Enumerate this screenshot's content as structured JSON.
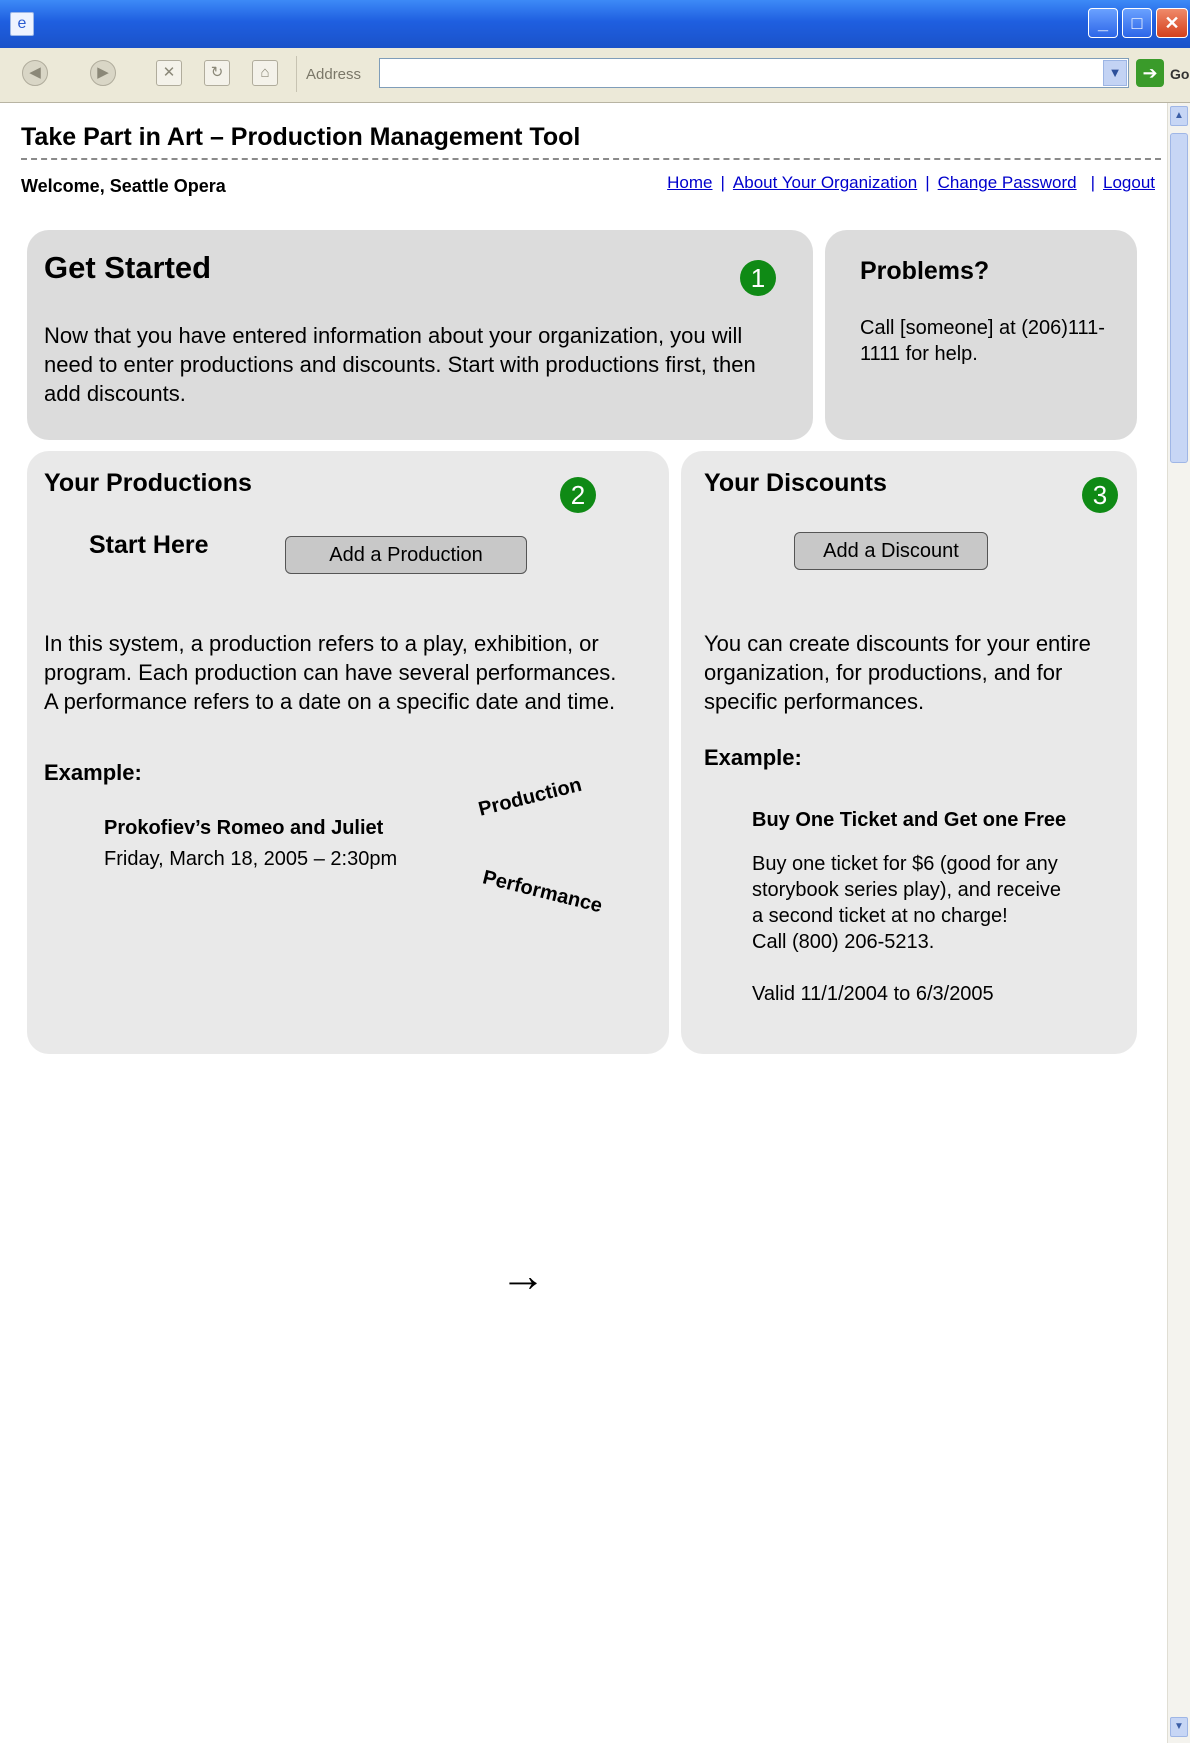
{
  "browser": {
    "address_label": "Address",
    "address_value": "",
    "go_label": "Go"
  },
  "page": {
    "title": "Take Part in Art – Production Management Tool",
    "welcome": "Welcome, Seattle Opera",
    "nav": [
      {
        "label": "Home"
      },
      {
        "label": "About Your Organization"
      },
      {
        "label": "Change Password"
      },
      {
        "label": "Logout"
      }
    ],
    "nav_separator": "|"
  },
  "get_started": {
    "heading": "Get Started",
    "step": "1",
    "body": "Now that you have entered information about your organization, you will need to enter productions and discounts. Start with productions first, then add discounts."
  },
  "problems": {
    "heading": "Problems?",
    "body": "Call [someone] at (206)111-1111 for help."
  },
  "productions": {
    "heading": "Your Productions",
    "step": "2",
    "start_here": "Start Here",
    "add_button": "Add a Production",
    "body": "In this system, a production refers to a play, exhibition, or program. Each production can have several performances. A performance refers to a date on a specific date and time.",
    "example_label": "Example:",
    "example_title": "Prokofiev’s Romeo and Juliet",
    "example_date": "Friday, March 18, 2005 – 2:30pm",
    "tag_production": "Production",
    "tag_performance": "Performance"
  },
  "discounts": {
    "heading": "Your Discounts",
    "step": "3",
    "add_button": "Add a Discount",
    "body": "You can create discounts for your entire organization, for productions, and for specific performances.",
    "example_label": "Example:",
    "example_title": "Buy One Ticket and Get one Free",
    "example_body_1": "Buy one ticket for $6 (good for any",
    "example_body_2": "storybook series play), and receive",
    "example_body_3": "a second ticket at no charge!",
    "example_body_4": "Call (800) 206-5213.",
    "example_valid": "Valid 11/1/2004 to 6/3/2005"
  },
  "arrow": "→"
}
